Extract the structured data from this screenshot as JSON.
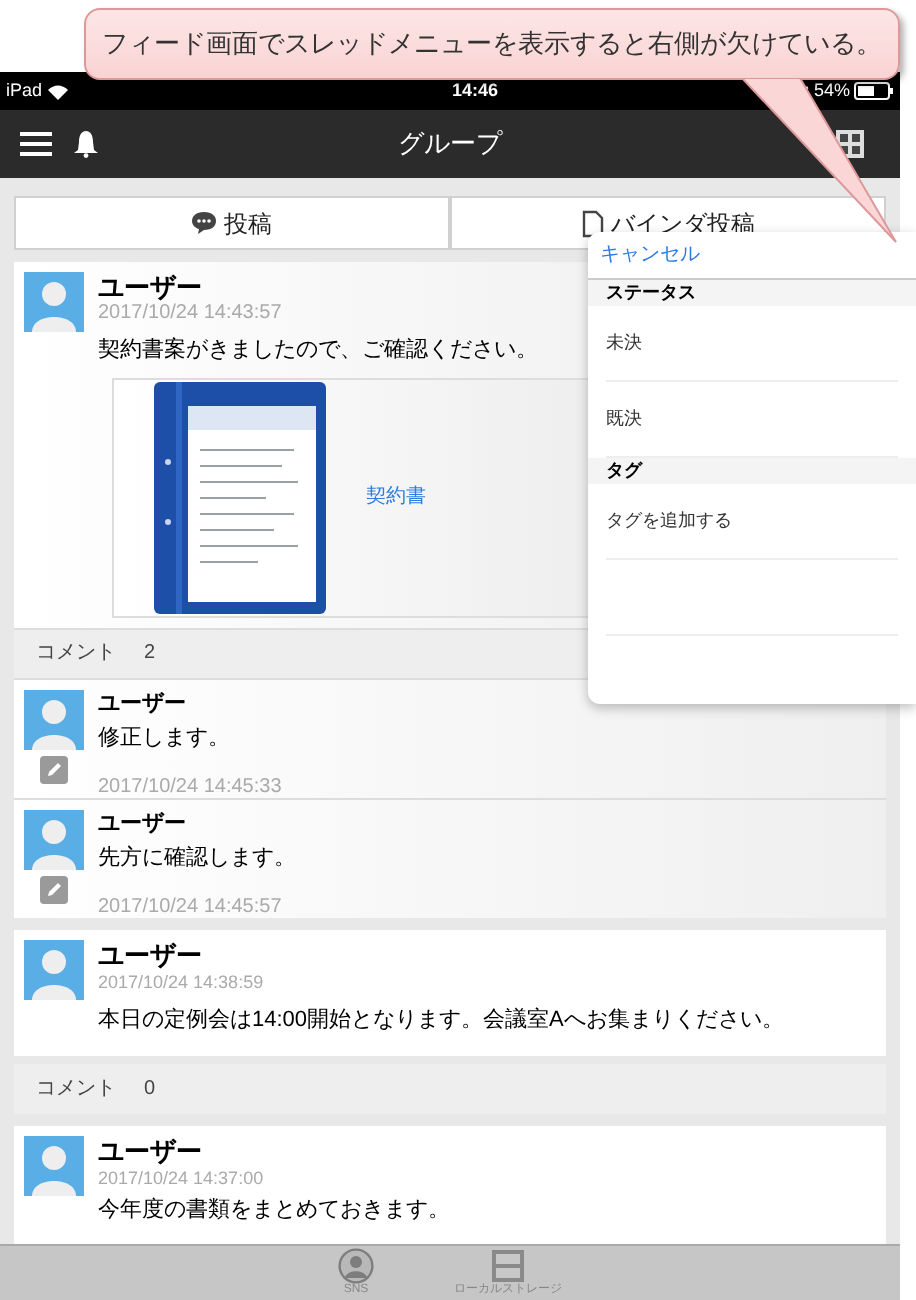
{
  "annotation": {
    "text": "フィード画面でスレッドメニューを表示すると右側が欠けている。"
  },
  "status_bar": {
    "device": "iPad",
    "time": "14:46",
    "battery": "54%"
  },
  "nav": {
    "title": "グループ"
  },
  "tabs": [
    {
      "label": "投稿",
      "kind": "chat"
    },
    {
      "label": "バインダ投稿",
      "kind": "file"
    }
  ],
  "posts": [
    {
      "user": "ユーザー",
      "date": "2017/10/24 14:43:57",
      "message": "契約書案がきましたので、ご確認ください。",
      "attachment": {
        "label": "契約書"
      },
      "comments_label": "コメント",
      "comment_count": "2",
      "comments": [
        {
          "user": "ユーザー",
          "message": "修正します。",
          "date": "2017/10/24 14:45:33"
        },
        {
          "user": "ユーザー",
          "message": "先方に確認します。",
          "date": "2017/10/24 14:45:57"
        }
      ]
    },
    {
      "user": "ユーザー",
      "date": "2017/10/24 14:38:59",
      "message": "本日の定例会は14:00開始となります。会議室Aへお集まりください。",
      "comments_label": "コメント",
      "comment_count": "0"
    },
    {
      "user": "ユーザー",
      "date": "2017/10/24 14:37:00",
      "message": "今年度の書類をまとめておきます。"
    }
  ],
  "thread_menu": {
    "cancel": "キャンセル",
    "sections": [
      {
        "title": "ステータス",
        "items": [
          "未決",
          "既決"
        ]
      },
      {
        "title": "タグ",
        "items": [
          "タグを追加する"
        ]
      }
    ]
  },
  "bottom_tabs": [
    {
      "label": "SNS",
      "kind": "person"
    },
    {
      "label": "ローカルストレージ",
      "kind": "storage"
    }
  ]
}
